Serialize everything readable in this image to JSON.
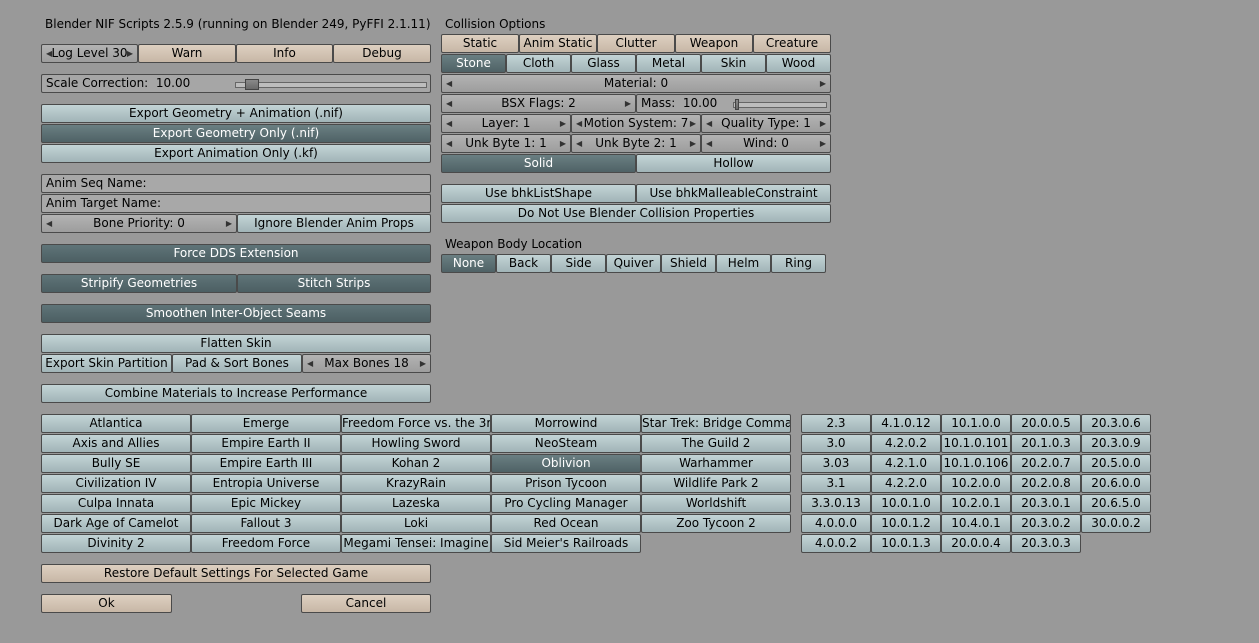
{
  "title": "Blender NIF Scripts 2.5.9 (running on Blender 249, PyFFI 2.1.11)",
  "log": {
    "level_label": "Log Level 30",
    "warn": "Warn",
    "info": "Info",
    "debug": "Debug"
  },
  "scale": {
    "label": "Scale Correction:",
    "value": "10.00",
    "level": 0.05
  },
  "export": {
    "geom_anim": "Export Geometry + Animation (.nif)",
    "geom_only": "Export Geometry Only (.nif)",
    "anim_only": "Export Animation Only (.kf)"
  },
  "anim": {
    "seq_name": "Anim Seq Name:",
    "target_name": "Anim Target Name:",
    "bone_priority": "Bone Priority: 0",
    "ignore_props": "Ignore Blender Anim Props"
  },
  "options": {
    "force_dds": "Force DDS Extension",
    "stripify": "Stripify Geometries",
    "stitch": "Stitch Strips",
    "smoothen": "Smoothen Inter-Object Seams",
    "flatten_skin": "Flatten Skin",
    "export_skin_partition": "Export Skin Partition",
    "pad_sort": "Pad & Sort Bones",
    "max_bones": "Max Bones 18",
    "combine_materials": "Combine Materials to Increase Performance"
  },
  "collision": {
    "header": "Collision Options",
    "types": [
      "Static",
      "Anim Static",
      "Clutter",
      "Weapon",
      "Creature"
    ],
    "materials": [
      "Stone",
      "Cloth",
      "Glass",
      "Metal",
      "Skin",
      "Wood"
    ],
    "material_field": "Material:  0",
    "bsx_flags": "BSX Flags:  2",
    "mass": {
      "label": "Mass:",
      "value": "10.00",
      "level": 0.02
    },
    "layer": "Layer:  1",
    "motion_system": "Motion System:  7",
    "quality_type": "Quality Type:  1",
    "unk_byte_1": "Unk Byte 1:  1",
    "unk_byte_2": "Unk Byte 2:  1",
    "wind": "Wind:  0",
    "solid": "Solid",
    "hollow": "Hollow",
    "bhk_list_shape": "Use bhkListShape",
    "bhk_malleable": "Use bhkMalleableConstraint",
    "no_blender_collision": "Do Not Use Blender Collision Properties"
  },
  "weapon": {
    "header": "Weapon Body Location",
    "locations": [
      "None",
      "Back",
      "Side",
      "Quiver",
      "Shield",
      "Helm",
      "Ring"
    ]
  },
  "games": {
    "selected": "Oblivion",
    "columns": [
      [
        "Atlantica",
        "Axis and Allies",
        "Bully SE",
        "Civilization IV",
        "Culpa Innata",
        "Dark Age of Camelot",
        "Divinity 2"
      ],
      [
        "Emerge",
        "Empire Earth II",
        "Empire Earth III",
        "Entropia Universe",
        "Epic Mickey",
        "Fallout 3",
        "Freedom Force"
      ],
      [
        "Freedom Force vs. the 3r",
        "Howling Sword",
        "Kohan 2",
        "KrazyRain",
        "Lazeska",
        "Loki",
        "Megami Tensei: Imagine"
      ],
      [
        "Morrowind",
        "NeoSteam",
        "Oblivion",
        "Prison Tycoon",
        "Pro Cycling Manager",
        "Red Ocean",
        "Sid Meier's Railroads"
      ],
      [
        "Star Trek: Bridge Comman",
        "The Guild 2",
        "Warhammer",
        "Wildlife Park 2",
        "Worldshift",
        "Zoo Tycoon 2"
      ]
    ]
  },
  "versions": {
    "columns": [
      [
        "2.3",
        "3.0",
        "3.03",
        "3.1",
        "3.3.0.13",
        "4.0.0.0",
        "4.0.0.2"
      ],
      [
        "4.1.0.12",
        "4.2.0.2",
        "4.2.1.0",
        "4.2.2.0",
        "10.0.1.0",
        "10.0.1.2",
        "10.0.1.3"
      ],
      [
        "10.1.0.0",
        "10.1.0.101",
        "10.1.0.106",
        "10.2.0.0",
        "10.2.0.1",
        "10.4.0.1",
        "20.0.0.4"
      ],
      [
        "20.0.0.5",
        "20.1.0.3",
        "20.2.0.7",
        "20.2.0.8",
        "20.3.0.1",
        "20.3.0.2",
        "20.3.0.3"
      ],
      [
        "20.3.0.6",
        "20.3.0.9",
        "20.5.0.0",
        "20.6.0.0",
        "20.6.5.0",
        "30.0.0.2"
      ]
    ]
  },
  "footer": {
    "restore_defaults": "Restore Default Settings For Selected Game",
    "ok": "Ok",
    "cancel": "Cancel"
  },
  "arrows": {
    "left": "◀",
    "right": "▶"
  }
}
